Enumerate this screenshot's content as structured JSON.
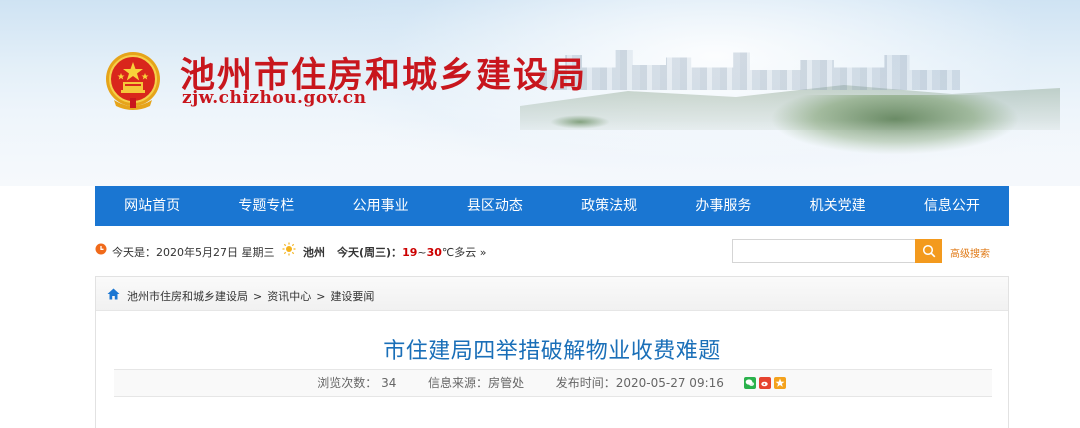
{
  "header": {
    "title": "池州市住房和城乡建设局",
    "url": "zjw.chizhou.gov.cn"
  },
  "nav": {
    "items": [
      "网站首页",
      "专题专栏",
      "公用事业",
      "县区动态",
      "政策法规",
      "办事服务",
      "机关党建",
      "信息公开"
    ]
  },
  "infobar": {
    "date": "今天是：2020年5月27日 星期三",
    "city": "池州",
    "weather_prefix": "今天(周三)：",
    "temp_low": "19",
    "temp_sep": "~",
    "temp_high": "30",
    "weather_suffix": "℃多云 »",
    "search_placeholder": "",
    "advanced_search": "高级搜索"
  },
  "breadcrumb": {
    "items": [
      "池州市住房和城乡建设局",
      "资讯中心",
      "建设要闻"
    ],
    "separator": ">"
  },
  "article": {
    "title": "市住建局四举措破解物业收费难题",
    "views_label": "浏览次数：",
    "views": "34",
    "source_label": "信息来源：",
    "source": "房管处",
    "published_label": "发布时间：",
    "published": "2020-05-27 09:16"
  },
  "colors": {
    "brand_red": "#c8161d",
    "nav_blue": "#1a76d2",
    "title_blue": "#1a6fb8",
    "search_orange": "#f39a1e",
    "wechat_green": "#2bb24c",
    "weibo_red": "#e6432f",
    "qzone_orange": "#f4a21d"
  },
  "icons": {
    "emblem": "national-emblem",
    "date": "clock-icon",
    "weather": "sun-icon",
    "search": "search-icon",
    "breadcrumb": "home-icon",
    "share": [
      "wechat-icon",
      "weibo-icon",
      "qzone-icon"
    ]
  }
}
